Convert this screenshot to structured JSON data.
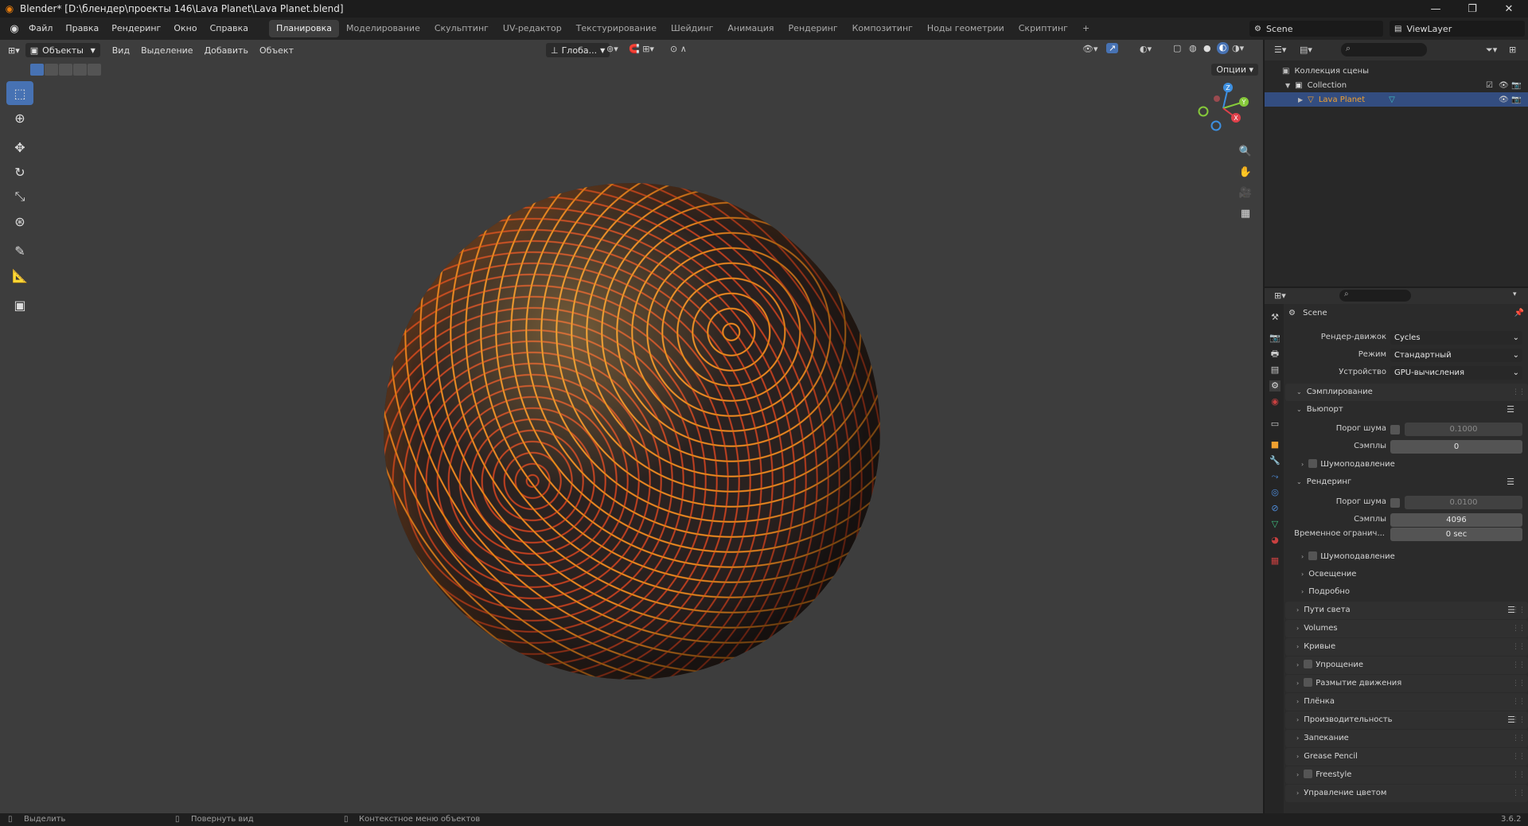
{
  "window": {
    "title": "Blender* [D:\\блендер\\проекты 146\\Lava Planet\\Lava Planet.blend]",
    "controls": [
      "—",
      "❐",
      "✕"
    ]
  },
  "menu": {
    "items": [
      "Файл",
      "Правка",
      "Рендеринг",
      "Окно",
      "Справка"
    ]
  },
  "workspaces": {
    "tabs": [
      "Планировка",
      "Моделирование",
      "Скульптинг",
      "UV-редактор",
      "Текстурирование",
      "Шейдинг",
      "Анимация",
      "Рендеринг",
      "Композитинг",
      "Ноды геометрии",
      "Скриптинг"
    ],
    "active": "Планировка",
    "add": "+"
  },
  "scene_selector": {
    "scene": "Scene",
    "view_layer": "ViewLayer"
  },
  "viewport": {
    "mode": "Объекты",
    "menus": [
      "Вид",
      "Выделение",
      "Добавить",
      "Объект"
    ],
    "transform_orientation": "Глоба...",
    "options": "Опции",
    "gizmo_axes": {
      "z": "Z",
      "y": "Y",
      "x": "X"
    },
    "colors": {
      "x": "#e0404a",
      "y": "#86c93a",
      "z": "#3d8fe0",
      "lava_bright": "#f5a515",
      "lava_deep": "#c2400f",
      "rock": "#2a2220"
    }
  },
  "toolbar": {
    "tools": [
      "select-box",
      "cursor",
      "move",
      "rotate",
      "scale",
      "transform",
      "annotate",
      "measure",
      "add-cube"
    ]
  },
  "statusbar": {
    "select": "Выделить",
    "rotate_view": "Повернуть вид",
    "context_menu": "Контекстное меню объектов",
    "version": "3.6.2"
  },
  "outliner": {
    "root": "Коллекция сцены",
    "collection": "Collection",
    "object": "Lava Planet"
  },
  "properties": {
    "context": "Scene",
    "render_engine_label": "Рендер-движок",
    "render_engine": "Cycles",
    "mode_label": "Режим",
    "mode": "Стандартный",
    "device_label": "Устройство",
    "device": "GPU-вычисления",
    "sampling": "Сэмплирование",
    "viewport": {
      "title": "Вьюпорт",
      "noise_threshold_label": "Порог шума",
      "noise_threshold": "0.1000",
      "samples_label": "Сэмплы",
      "samples": "0",
      "denoise": "Шумоподавление"
    },
    "render": {
      "title": "Рендеринг",
      "noise_threshold_label": "Порог шума",
      "noise_threshold": "0.0100",
      "samples_label": "Сэмплы",
      "samples": "4096",
      "time_limit_label": "Временное огранич...",
      "time_limit": "0 sec",
      "denoise": "Шумоподавление",
      "lights": "Освещение",
      "advanced": "Подробно"
    },
    "panels": [
      "Пути света",
      "Volumes",
      "Кривые",
      "Упрощение",
      "Размытие движения",
      "Плёнка",
      "Производительность",
      "Запекание",
      "Grease Pencil",
      "Freestyle",
      "Управление цветом"
    ]
  }
}
